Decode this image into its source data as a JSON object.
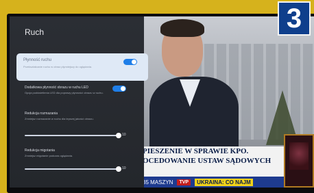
{
  "settings": {
    "title": "Ruch",
    "items": [
      {
        "label": "Płynność ruchu",
        "desc": "Przekształcanie ruchu w obraz płynniejszy do oglądania.",
        "toggle_on": true,
        "selected": true
      },
      {
        "label": "Dodatkowa płynność obrazu w ruchu LED",
        "desc": "Opcja podświetlenia LED dla poprawy płynności obrazu w ruchu.",
        "toggle_on": true,
        "selected": false
      },
      {
        "label": "Redukcja rozmazania",
        "desc": "Zmniejsz rozmazanie w ruchu dla lepszej jakości obrazu.",
        "value": "10",
        "level": 1.0
      },
      {
        "label": "Redukcja migotania",
        "desc": "Zmniejsz migotanie podczas oglądania.",
        "value": "10",
        "level": 1.0
      }
    ]
  },
  "broadcast": {
    "ticker_line1": "PIESZENIE W SPRAWIE KPO.",
    "ticker_line2": "OCEDOWANIE USTAW SĄDOWYCH",
    "bottom_left": "35 MASZYN",
    "badge": "TVP",
    "bottom_headline": "UKRAINA: CO NAJM"
  },
  "corner_badge": {
    "text": "3",
    "color": "#0f3f8c"
  },
  "colors": {
    "panel_bg": "#2b2e34",
    "selected_bg": "#dfe9f6",
    "accent": "#1f7ee8",
    "wall": "#d6b21c"
  }
}
